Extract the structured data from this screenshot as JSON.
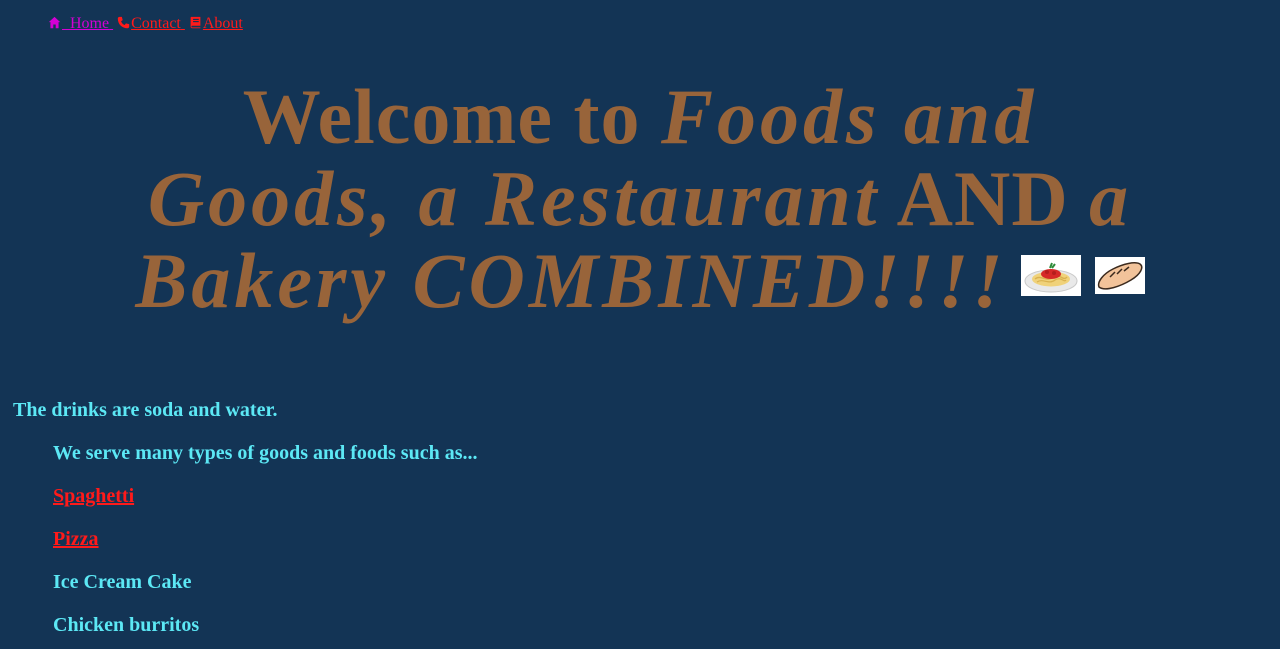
{
  "nav": {
    "items": [
      {
        "label": "  Home",
        "icon": "home-icon",
        "color": "#d400d4"
      },
      {
        "label": "Contact",
        "icon": "phone-icon",
        "color": "#ff1a1a"
      },
      {
        "label": "About",
        "icon": "book-icon",
        "color": "#ff1a1a"
      }
    ]
  },
  "hero": {
    "part1": "Welcome to ",
    "part2": "Foods and Goods, a Restaurant",
    "part3": " AND ",
    "part4": "a Bakery COMBINED!!!!",
    "images": [
      "spaghetti-image",
      "bread-image"
    ]
  },
  "content": {
    "drinks": "The drinks are soda and water.",
    "intro": "We serve many types of goods and foods such as...",
    "items": [
      {
        "label": "Spaghetti",
        "link": true
      },
      {
        "label": "Pizza",
        "link": true
      },
      {
        "label": "Ice Cream Cake",
        "link": false
      },
      {
        "label": "Chicken burritos",
        "link": false
      }
    ]
  },
  "colors": {
    "background": "#133455",
    "hero_text": "#98643a",
    "body_text": "#5ce8f5",
    "link": "#ff1a1a",
    "home_link": "#d400d4"
  }
}
